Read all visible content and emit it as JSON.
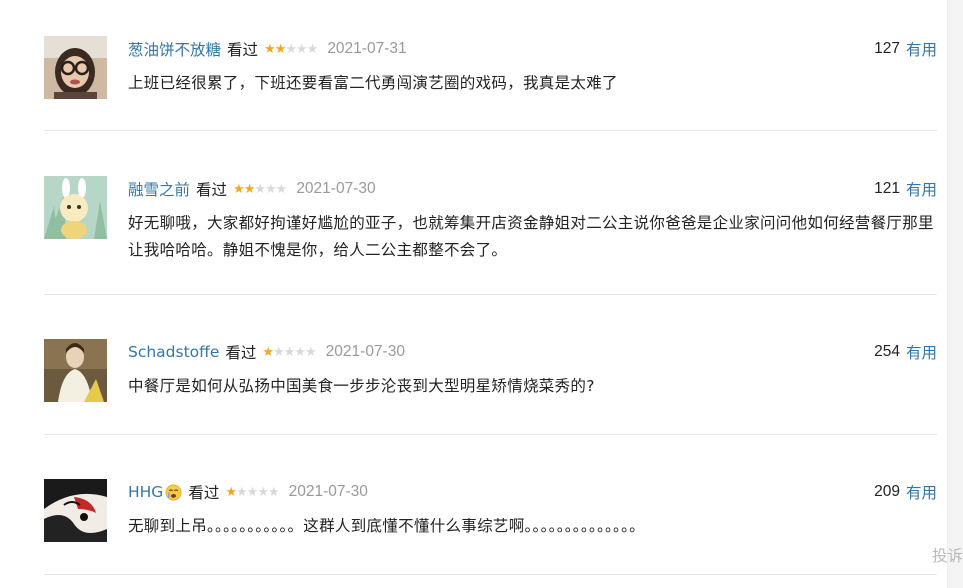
{
  "comments": [
    {
      "user": "葱油饼不放糖",
      "status": "看过",
      "rating": 2,
      "date": "2021-07-31",
      "votes": "127",
      "vote_label": "有用",
      "text": "上班已经很累了，下班还要看富二代勇闯演艺圈的戏码，我真是太难了"
    },
    {
      "user": "融雪之前",
      "status": "看过",
      "rating": 2,
      "date": "2021-07-30",
      "votes": "121",
      "vote_label": "有用",
      "text": "好无聊哦，大家都好拘谨好尴尬的亚子，也就筹集开店资金静姐对二公主说你爸爸是企业家问问他如何经营餐厅那里让我哈哈哈。静姐不愧是你，给人二公主都整不会了。"
    },
    {
      "user": "Schadstoffe",
      "status": "看过",
      "rating": 1,
      "date": "2021-07-30",
      "votes": "254",
      "vote_label": "有用",
      "text": "中餐厅是如何从弘扬中国美食一步步沦丧到大型明星矫情烧菜秀的?"
    },
    {
      "user": "HHG",
      "status": "看过",
      "rating": 1,
      "date": "2021-07-30",
      "votes": "209",
      "vote_label": "有用",
      "text": "无聊到上吊。。。。。。。。。。。这群人到底懂不懂什么事综艺啊。。。。。。。。。。。。。。"
    }
  ],
  "report_label": "投诉",
  "icons": {
    "star": "star-icon",
    "emoji": "crying-face-icon"
  },
  "colors": {
    "link": "#3377aa",
    "star_on": "#f5a623",
    "star_off": "#d9d9d9",
    "date": "#999999",
    "divider": "#e6e6e6"
  },
  "max_rating": 5
}
